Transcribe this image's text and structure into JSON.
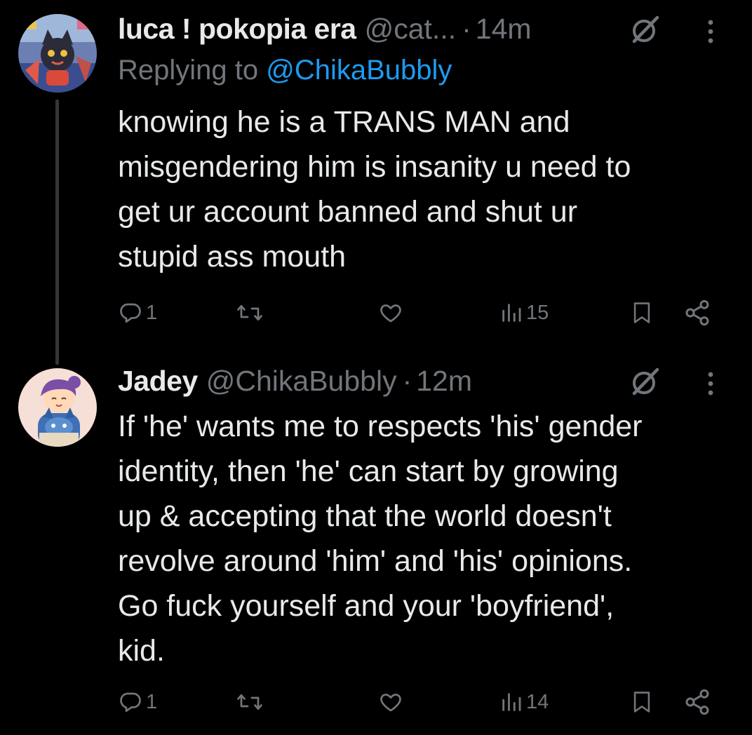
{
  "tweets": [
    {
      "display_name": "luca ! pokopia era",
      "handle": "@cat...",
      "separator": "·",
      "time": "14m",
      "replying_prefix": "Replying to",
      "replying_to": "@ChikaBubbly",
      "text": "knowing he is a TRANS MAN and\nmisgendering him is insanity u need to\nget ur account banned and shut ur\nstupid ass mouth",
      "reply_count": "1",
      "view_count": "15"
    },
    {
      "display_name": "Jadey",
      "handle": "@ChikaBubbly",
      "separator": "·",
      "time": "12m",
      "text": "If 'he' wants me to respects 'his' gender\nidentity, then 'he' can start by growing\nup & accepting that the world doesn't\nrevolve around 'him' and 'his' opinions.\nGo fuck yourself and your 'boyfriend',\nkid.",
      "reply_count": "1",
      "view_count": "14"
    }
  ],
  "icons": {
    "grok": "grok-icon",
    "more": "more-icon",
    "reply": "reply-icon",
    "retweet": "retweet-icon",
    "like": "like-icon",
    "views": "views-icon",
    "bookmark": "bookmark-icon",
    "share": "share-icon"
  },
  "colors": {
    "background": "#000000",
    "text_primary": "#e7e9ea",
    "text_secondary": "#71767b",
    "link": "#1d9bf0",
    "thread_line": "#333639"
  }
}
